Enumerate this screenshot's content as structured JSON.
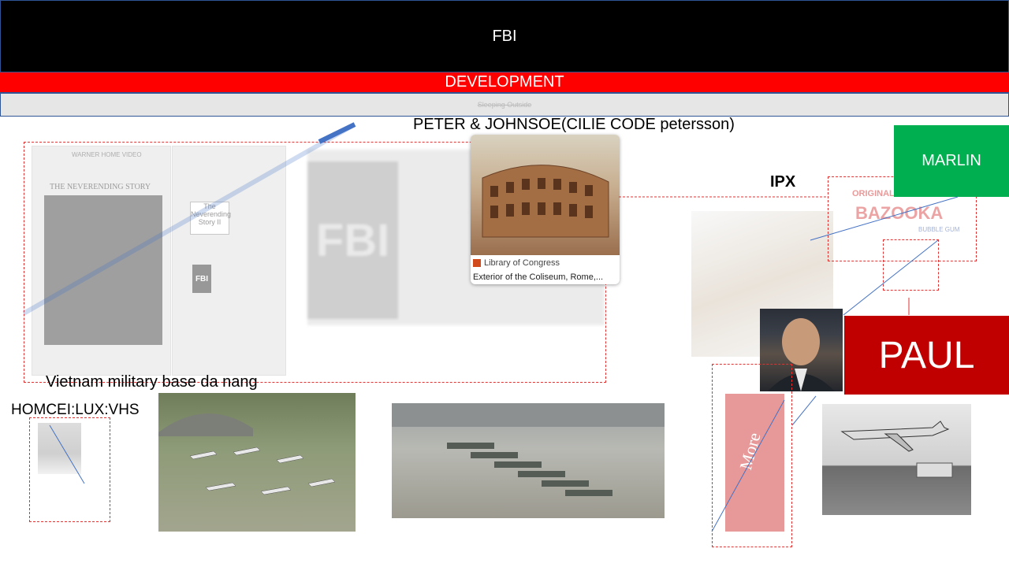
{
  "header": {
    "title": "FBI"
  },
  "development_bar": {
    "label": "DEVELOPMENT"
  },
  "sub_bar": {
    "label": "Sleeping Outside"
  },
  "captions": {
    "peter": "PETER & JOHNSOE(CILIE CODE petersson)",
    "ipx": "IPX",
    "vietnam": "Vietnam military base da nang",
    "homcei": "HOMCEI:LUX:VHS"
  },
  "boxes": {
    "marlin": "MARLIN",
    "paul": "PAUL"
  },
  "vhs": {
    "cover1_brand": "WARNER HOME VIDEO",
    "cover1_title": "THE NEVERENDING STORY",
    "cover2_title": "The Neverending Story II",
    "cover2_logo": "FBI"
  },
  "fbi_warning": {
    "logo": "FBI"
  },
  "coliseum_card": {
    "source": "Library of Congress",
    "title": "Exterior of the Coliseum, Rome,..."
  },
  "bazooka": {
    "brand": "BAZOOKA",
    "tag": "ORIGINAL",
    "sub": "BUBBLE GUM"
  },
  "more_pack": {
    "brand": "More"
  },
  "colors": {
    "red": "#ff0000",
    "dark_red": "#c00000",
    "green": "#00b050",
    "accent_blue": "#4472c4"
  }
}
